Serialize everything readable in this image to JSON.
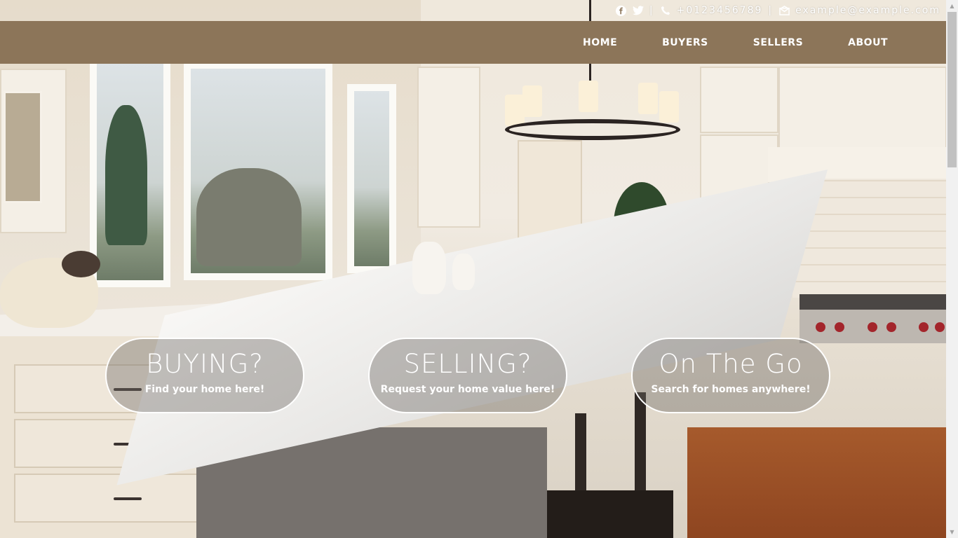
{
  "topbar": {
    "facebook_icon": "facebook-icon",
    "twitter_icon": "twitter-icon",
    "separator1": "|",
    "phone_icon": "phone-icon",
    "phone": "+0123456789",
    "separator2": "|",
    "email_icon": "envelope-icon",
    "email": "example@example.com"
  },
  "nav": {
    "items": [
      {
        "label": "HOME"
      },
      {
        "label": "BUYERS"
      },
      {
        "label": "SELLERS"
      },
      {
        "label": "ABOUT"
      }
    ]
  },
  "hero": {
    "cards": [
      {
        "title": "BUYING?",
        "subtitle": "Find your home here!"
      },
      {
        "title": "SELLING?",
        "subtitle": "Request your home value here!"
      },
      {
        "title": "On The Go",
        "subtitle": "Search for homes anywhere!"
      }
    ]
  },
  "colors": {
    "navbar": "#8c7559",
    "text": "#ffffff",
    "pill_fill": "rgba(110,105,100,0.40)"
  }
}
